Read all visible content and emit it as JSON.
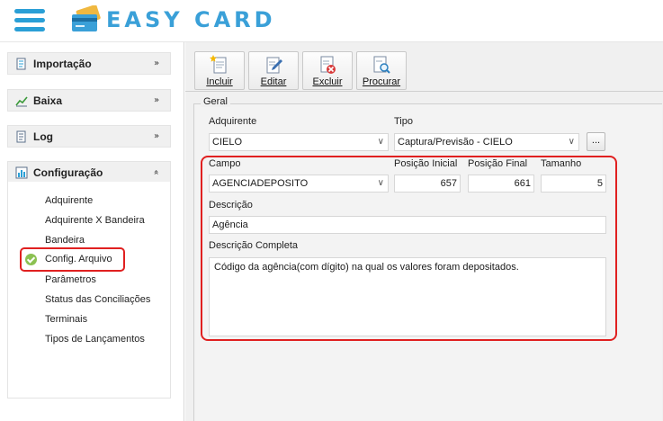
{
  "app": {
    "logo_text": "EASY CARD"
  },
  "sidebar": {
    "sections": [
      {
        "label": "Importação",
        "icon": "import-document-icon",
        "chevron": "double-chevron-down-icon"
      },
      {
        "label": "Baixa",
        "icon": "chart-trend-icon",
        "chevron": "double-chevron-down-icon"
      },
      {
        "label": "Log",
        "icon": "log-document-icon",
        "chevron": "double-chevron-down-icon"
      },
      {
        "label": "Configuração",
        "icon": "configuration-chart-icon",
        "chevron": "double-chevron-up-icon"
      }
    ],
    "config_items": [
      "Adquirente",
      "Adquirente X Bandeira",
      "Bandeira",
      "Config. Arquivo",
      "Parâmetros",
      "Status das Conciliações",
      "Terminais",
      "Tipos de Lançamentos"
    ],
    "active_item": "Config. Arquivo",
    "active_color": "#8cc152"
  },
  "toolbar": {
    "incluir": "Incluir",
    "editar": "Editar",
    "excluir": "Excluir",
    "procurar": "Procurar"
  },
  "form": {
    "group_title": "Geral",
    "adquirente_label": "Adquirente",
    "adquirente_value": "CIELO",
    "tipo_label": "Tipo",
    "tipo_value": "Captura/Previsão - CIELO",
    "tipo_button": "...",
    "campo_label": "Campo",
    "campo_value": "AGENCIADEPOSITO",
    "posicao_inicial_label": "Posição Inicial",
    "posicao_inicial_value": "657",
    "posicao_final_label": "Posição Final",
    "posicao_final_value": "661",
    "tamanho_label": "Tamanho",
    "tamanho_value": "5",
    "descricao_label": "Descrição",
    "descricao_value": "Agência",
    "descricao_completa_label": "Descrição Completa",
    "descricao_completa_value": "Código da agência(com dígito) na qual os valores foram depositados."
  },
  "colors": {
    "accent": "#2a9fd6",
    "highlight": "#e02020"
  }
}
